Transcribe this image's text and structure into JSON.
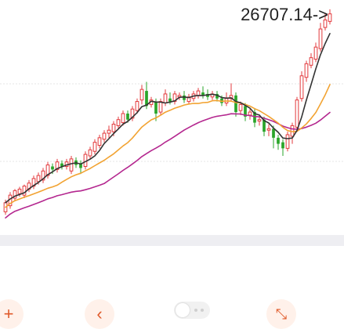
{
  "chart_data": {
    "type": "candlestick",
    "latest_value_label": "26707.14->",
    "colors": {
      "up": "#e3393c",
      "down": "#2aa52a",
      "ma_short": "#333333",
      "ma_mid": "#f2a332",
      "ma_long": "#b4278f"
    },
    "candles": [
      {
        "o": 0,
        "c": 12,
        "h": 16,
        "l": -4
      },
      {
        "o": 8,
        "c": 22,
        "h": 26,
        "l": 4
      },
      {
        "o": 18,
        "c": 28,
        "h": 30,
        "l": 14
      },
      {
        "o": 24,
        "c": 30,
        "h": 33,
        "l": 20
      },
      {
        "o": 22,
        "c": 34,
        "h": 36,
        "l": 18
      },
      {
        "o": 30,
        "c": 38,
        "h": 42,
        "l": 26
      },
      {
        "o": 34,
        "c": 44,
        "h": 48,
        "l": 30
      },
      {
        "o": 40,
        "c": 48,
        "h": 52,
        "l": 36
      },
      {
        "o": 42,
        "c": 54,
        "h": 58,
        "l": 38
      },
      {
        "o": 48,
        "c": 62,
        "h": 66,
        "l": 44
      },
      {
        "o": 60,
        "c": 56,
        "h": 64,
        "l": 50
      },
      {
        "o": 56,
        "c": 66,
        "h": 70,
        "l": 52
      },
      {
        "o": 64,
        "c": 60,
        "h": 68,
        "l": 56
      },
      {
        "o": 60,
        "c": 66,
        "h": 70,
        "l": 56
      },
      {
        "o": 54,
        "c": 70,
        "h": 74,
        "l": 50
      },
      {
        "o": 68,
        "c": 62,
        "h": 72,
        "l": 58
      },
      {
        "o": 64,
        "c": 58,
        "h": 68,
        "l": 50
      },
      {
        "o": 60,
        "c": 76,
        "h": 80,
        "l": 56
      },
      {
        "o": 74,
        "c": 82,
        "h": 86,
        "l": 70
      },
      {
        "o": 80,
        "c": 92,
        "h": 96,
        "l": 76
      },
      {
        "o": 88,
        "c": 98,
        "h": 102,
        "l": 84
      },
      {
        "o": 96,
        "c": 104,
        "h": 108,
        "l": 92
      },
      {
        "o": 104,
        "c": 108,
        "h": 114,
        "l": 98
      },
      {
        "o": 106,
        "c": 116,
        "h": 120,
        "l": 100
      },
      {
        "o": 114,
        "c": 122,
        "h": 126,
        "l": 110
      },
      {
        "o": 118,
        "c": 130,
        "h": 134,
        "l": 114
      },
      {
        "o": 130,
        "c": 122,
        "h": 134,
        "l": 118
      },
      {
        "o": 124,
        "c": 136,
        "h": 140,
        "l": 120
      },
      {
        "o": 134,
        "c": 146,
        "h": 150,
        "l": 130
      },
      {
        "o": 148,
        "c": 162,
        "h": 168,
        "l": 142
      },
      {
        "o": 160,
        "c": 140,
        "h": 172,
        "l": 136
      },
      {
        "o": 142,
        "c": 148,
        "h": 152,
        "l": 138
      },
      {
        "o": 146,
        "c": 130,
        "h": 150,
        "l": 120
      },
      {
        "o": 132,
        "c": 146,
        "h": 150,
        "l": 128
      },
      {
        "o": 144,
        "c": 156,
        "h": 162,
        "l": 140
      },
      {
        "o": 150,
        "c": 146,
        "h": 158,
        "l": 142
      },
      {
        "o": 146,
        "c": 156,
        "h": 160,
        "l": 142
      },
      {
        "o": 152,
        "c": 154,
        "h": 158,
        "l": 148
      },
      {
        "o": 154,
        "c": 148,
        "h": 160,
        "l": 144
      },
      {
        "o": 146,
        "c": 152,
        "h": 156,
        "l": 142
      },
      {
        "o": 150,
        "c": 156,
        "h": 160,
        "l": 146
      },
      {
        "o": 154,
        "c": 160,
        "h": 164,
        "l": 150
      },
      {
        "o": 158,
        "c": 154,
        "h": 166,
        "l": 150
      },
      {
        "o": 156,
        "c": 152,
        "h": 162,
        "l": 148
      },
      {
        "o": 152,
        "c": 156,
        "h": 160,
        "l": 148
      },
      {
        "o": 156,
        "c": 150,
        "h": 160,
        "l": 146
      },
      {
        "o": 150,
        "c": 144,
        "h": 154,
        "l": 140
      },
      {
        "o": 144,
        "c": 150,
        "h": 158,
        "l": 140
      },
      {
        "o": 150,
        "c": 154,
        "h": 170,
        "l": 146
      },
      {
        "o": 154,
        "c": 132,
        "h": 158,
        "l": 126
      },
      {
        "o": 134,
        "c": 142,
        "h": 146,
        "l": 128
      },
      {
        "o": 140,
        "c": 126,
        "h": 144,
        "l": 120
      },
      {
        "o": 128,
        "c": 132,
        "h": 136,
        "l": 122
      },
      {
        "o": 132,
        "c": 118,
        "h": 136,
        "l": 112
      },
      {
        "o": 120,
        "c": 122,
        "h": 126,
        "l": 114
      },
      {
        "o": 122,
        "c": 106,
        "h": 126,
        "l": 100
      },
      {
        "o": 108,
        "c": 110,
        "h": 116,
        "l": 100
      },
      {
        "o": 110,
        "c": 98,
        "h": 114,
        "l": 84
      },
      {
        "o": 98,
        "c": 90,
        "h": 102,
        "l": 82
      },
      {
        "o": 92,
        "c": 84,
        "h": 96,
        "l": 74
      },
      {
        "o": 84,
        "c": 102,
        "h": 106,
        "l": 80
      },
      {
        "o": 100,
        "c": 114,
        "h": 118,
        "l": 90
      },
      {
        "o": 112,
        "c": 148,
        "h": 152,
        "l": 108
      },
      {
        "o": 150,
        "c": 180,
        "h": 186,
        "l": 146
      },
      {
        "o": 178,
        "c": 196,
        "h": 200,
        "l": 172
      },
      {
        "o": 194,
        "c": 204,
        "h": 210,
        "l": 190
      },
      {
        "o": 202,
        "c": 218,
        "h": 224,
        "l": 198
      },
      {
        "o": 216,
        "c": 242,
        "h": 250,
        "l": 212
      },
      {
        "o": 244,
        "c": 254,
        "h": 262,
        "l": 240
      },
      {
        "o": 252,
        "c": 262,
        "h": 268,
        "l": 248
      }
    ],
    "y_range": [
      -10,
      270
    ]
  }
}
